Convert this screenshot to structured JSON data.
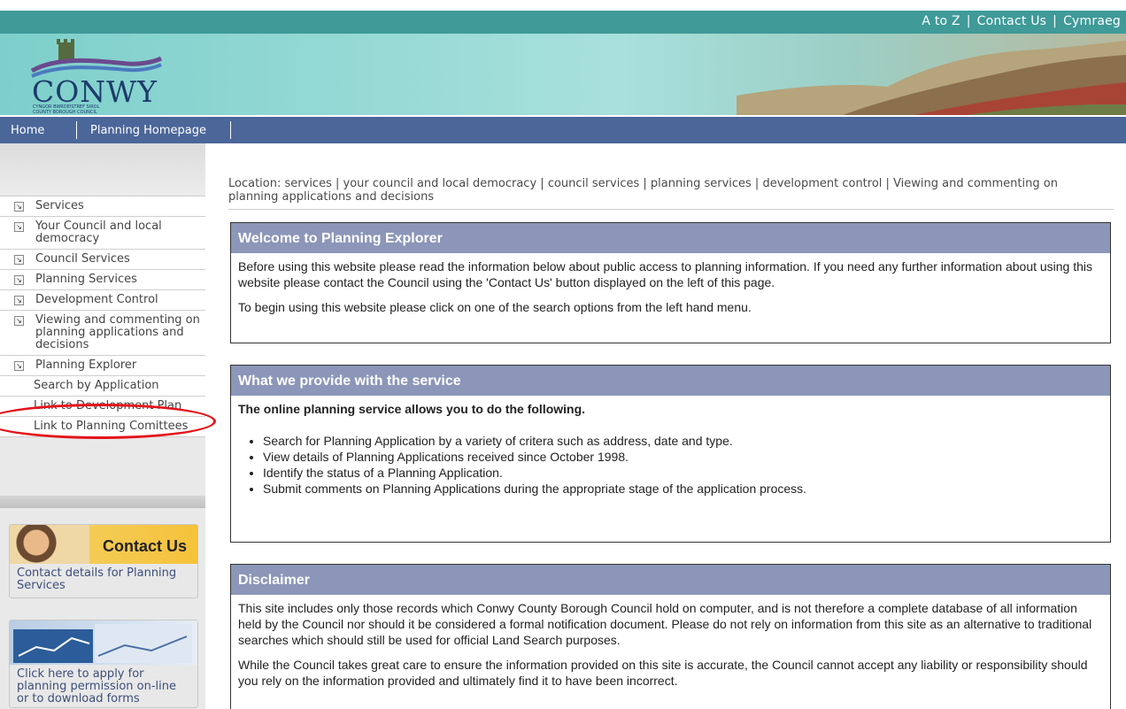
{
  "top_links": [
    "A to Z",
    "Contact Us",
    "Cymraeg"
  ],
  "logo": {
    "name": "CONWY",
    "subtitle_line1": "CYNGOR BWRDEISTREF SIROL",
    "subtitle_line2": "COUNTY BOROUGH COUNCIL"
  },
  "nav": {
    "home": "Home",
    "planning_homepage": "Planning Homepage"
  },
  "sidebar": {
    "menu": [
      {
        "label": "Services"
      },
      {
        "label": "Your Council and local democracy"
      },
      {
        "label": "Council Services"
      },
      {
        "label": "Planning Services"
      },
      {
        "label": "Development Control"
      },
      {
        "label": "Viewing and commenting on planning applications and decisions"
      },
      {
        "label": "Planning Explorer"
      }
    ],
    "submenu": [
      {
        "label": "Search by Application"
      },
      {
        "label": "Link to Development Plan"
      },
      {
        "label": "Link to Planning Comittees"
      }
    ],
    "contact_box": {
      "banner": "Contact Us",
      "text": "Contact details for Planning Services"
    },
    "forms_box": {
      "text": "Click here to apply for planning permission on-line or to download forms"
    }
  },
  "location": {
    "prefix": "Location:",
    "crumbs": [
      "services",
      "your council and local democracy",
      "council services",
      "planning services",
      "development control",
      "Viewing and commenting on planning applications and decisions"
    ]
  },
  "panels": {
    "welcome": {
      "title": "Welcome to Planning Explorer",
      "p1": "Before using this website please read the information below about public access to planning information. If you need any further information about using this website please contact the Council using the 'Contact Us' button displayed on the left of this page.",
      "p2": "To begin using this website please click on one of the search options from the left hand menu."
    },
    "provide": {
      "title": "What we provide with the service",
      "intro": "The online planning service allows you to do the following.",
      "items": [
        "Search for Planning Application by a variety of critera such as address, date and type.",
        "View details of Planning Applications received since October 1998.",
        "Identify the status of a Planning Application.",
        "Submit comments on Planning Applications during the appropriate stage of the application process."
      ]
    },
    "disclaimer": {
      "title": "Disclaimer",
      "p1": "This site includes only those records which Conwy County Borough Council hold on computer, and is not therefore a complete database of all information held by the Council nor should it be considered a formal notification document. Please do not rely on information from this site as an alternative to traditional searches which should still be used for official Land Search purposes.",
      "p2": "While the Council takes great care to ensure the information provided on this site is accurate, the Council cannot accept any liability or responsibility should you rely on the information provided and ultimately find it to have been incorrect."
    }
  },
  "colors": {
    "nav": "#4b6699",
    "panel_header": "#8b96b8",
    "topbar": "#3f9a98",
    "highlight": "#e4141a"
  }
}
